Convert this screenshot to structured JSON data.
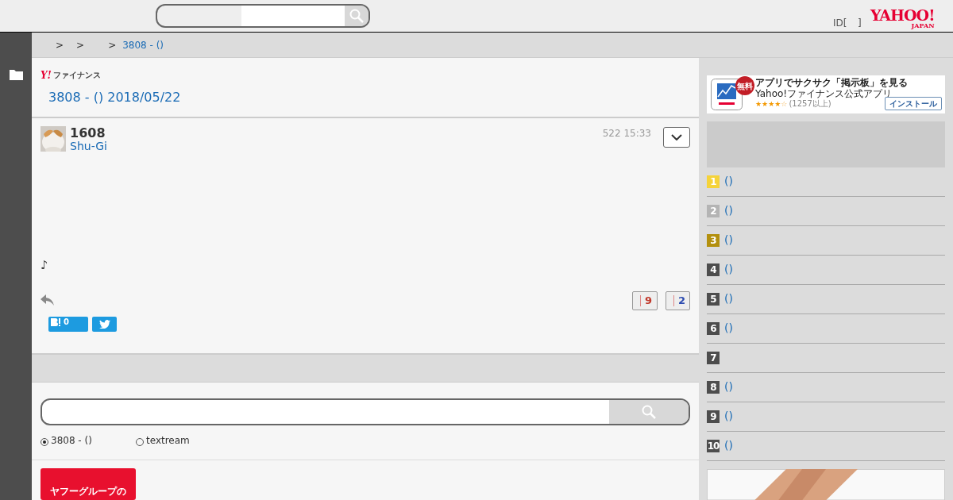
{
  "header": {
    "login_text": "ID[",
    "login_tail": "]",
    "logo": {
      "main": "YAHOO!",
      "sub": "JAPAN"
    }
  },
  "breadcrumb": [
    {
      "label": ">",
      "kind": "sep"
    },
    {
      "label": ">",
      "kind": "sep"
    },
    {
      "label": ">",
      "kind": "sep"
    },
    {
      "label": "3808 - ()",
      "kind": "link"
    }
  ],
  "brand_mark": "Y!",
  "brand": "ファイナンス",
  "page_title": "3808 - () 2018/05/22",
  "post": {
    "number": "1608",
    "author": "Shu-Gi",
    "time": "522 15:33",
    "body": "♪",
    "likes": "9",
    "dislikes": "2",
    "hatena_count": "0"
  },
  "search": {
    "options": [
      {
        "label": "3808 - ()",
        "selected": true
      },
      {
        "label": "textream",
        "selected": false
      }
    ]
  },
  "bottom_banner": "ヤフーグループの",
  "ad": {
    "badge": "無料",
    "title": "アプリでサクサク「掲示板」を見る",
    "subtitle": "Yahoo!ファイナンス公式アプリ",
    "stars": 4,
    "reviews": "(1257以上)",
    "button": "インストール"
  },
  "ranking": [
    {
      "rank": "1",
      "label": "()",
      "color": "#f5d33a"
    },
    {
      "rank": "2",
      "label": "()",
      "color": "#b4b4b4"
    },
    {
      "rank": "3",
      "label": "()",
      "color": "#b3900e"
    },
    {
      "rank": "4",
      "label": "()",
      "color": "#4d4d4d"
    },
    {
      "rank": "5",
      "label": "()",
      "color": "#4d4d4d"
    },
    {
      "rank": "6",
      "label": "()",
      "color": "#4d4d4d"
    },
    {
      "rank": "7",
      "color": "#4d4d4d"
    },
    {
      "rank": "8",
      "label": "()",
      "color": "#4d4d4d"
    },
    {
      "rank": "9",
      "label": "()",
      "color": "#4d4d4d"
    },
    {
      "rank": "10",
      "label": "()",
      "color": "#4d4d4d"
    }
  ]
}
